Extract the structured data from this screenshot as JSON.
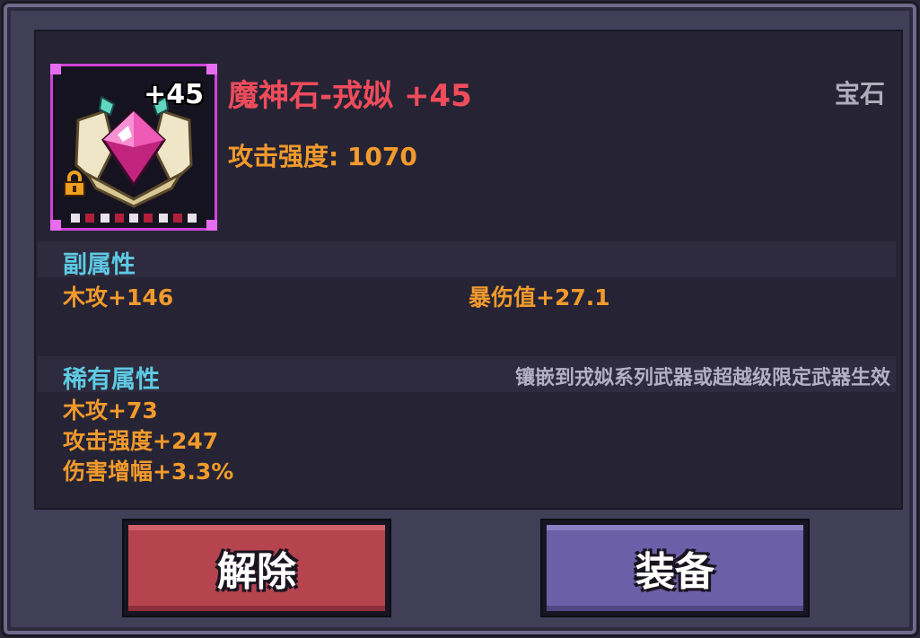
{
  "item": {
    "name": "魔神石-戎姒 +45",
    "type": "宝石",
    "level_badge": "+45",
    "main_stat": "攻击强度: 1070",
    "rarity_color": "#d044d8"
  },
  "secondary": {
    "title": "副属性",
    "attrs": [
      "木攻+146",
      "暴伤值+27.1"
    ]
  },
  "rare": {
    "title": "稀有属性",
    "note": "镶嵌到戎姒系列武器或超越级限定武器生效",
    "attrs": [
      "木攻+73",
      "攻击强度+247",
      "伤害增幅+3.3%"
    ]
  },
  "buttons": {
    "unequip": "解除",
    "equip": "装备"
  },
  "colors": {
    "name": "#f04c5c",
    "stat": "#f29a2c",
    "section": "#5ec9e3",
    "unequip_btn": "#b5444f",
    "equip_btn": "#6b60a8"
  }
}
